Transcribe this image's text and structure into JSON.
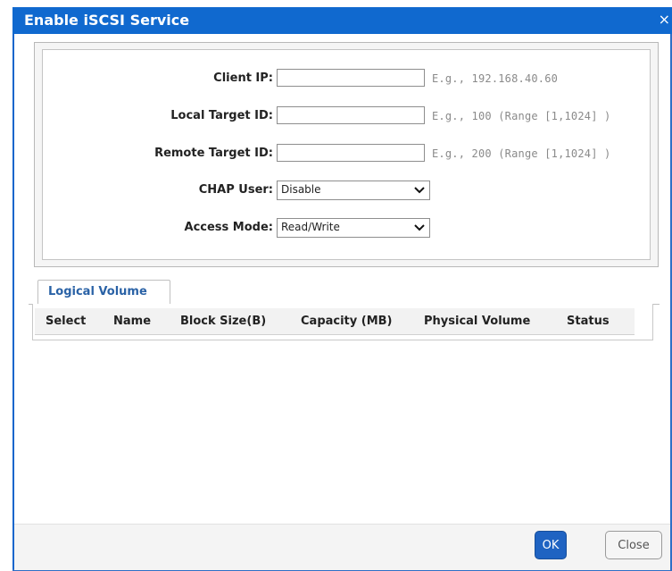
{
  "dialog": {
    "title": "Enable iSCSI Service",
    "close_glyph": "×"
  },
  "form": {
    "client_ip": {
      "label": "Client IP:",
      "value": "",
      "hint": "E.g., 192.168.40.60"
    },
    "local_target_id": {
      "label": "Local Target ID:",
      "value": "",
      "hint": "E.g., 100 (Range [1,1024] )"
    },
    "remote_target_id": {
      "label": "Remote Target ID:",
      "value": "",
      "hint": "E.g., 200 (Range [1,1024] )"
    },
    "chap_user": {
      "label": "CHAP User:",
      "selected": "Disable"
    },
    "access_mode": {
      "label": "Access Mode:",
      "selected": "Read/Write"
    }
  },
  "tabs": [
    {
      "label": "Logical Volume",
      "active": true
    }
  ],
  "table": {
    "columns": [
      "Select",
      "Name",
      "Block Size(B)",
      "Capacity (MB)",
      "Physical Volume",
      "Status"
    ],
    "rows": []
  },
  "footer": {
    "ok_label": "OK",
    "close_label": "Close"
  },
  "colors": {
    "titlebar": "#1069cf",
    "ok_button": "#1f63c2",
    "tab_label": "#2a62a6",
    "hint_text": "#8a8a8a"
  }
}
